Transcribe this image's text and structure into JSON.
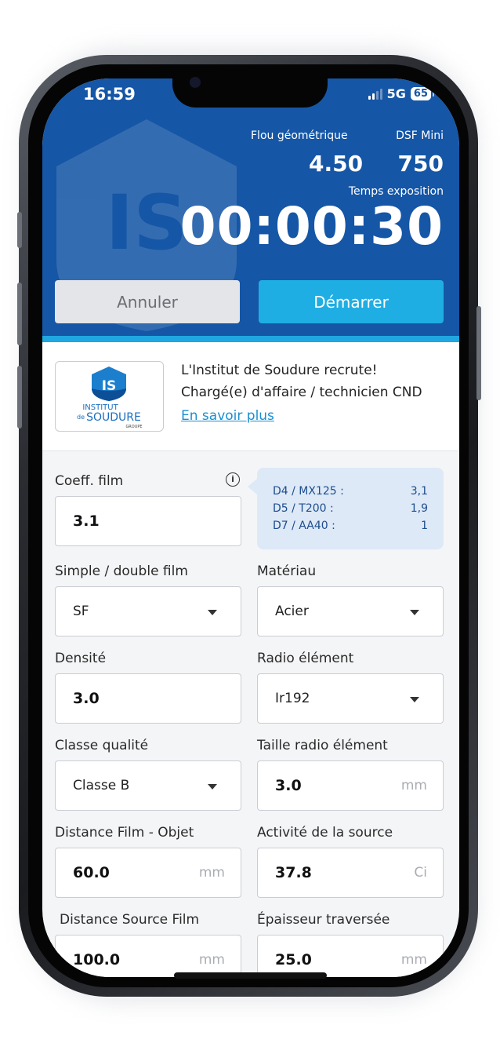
{
  "status_bar": {
    "time": "16:59",
    "network": "5G",
    "battery": "65"
  },
  "header": {
    "flou_label": "Flou géométrique",
    "flou_value": "4.50",
    "dsf_label": "DSF Mini",
    "dsf_value": "750",
    "temps_label": "Temps exposition",
    "timer": "00:00:30",
    "cancel_label": "Annuler",
    "start_label": "Démarrer",
    "bg_logo_text": "IS"
  },
  "ad": {
    "logo_badge": "IS",
    "logo_line1": "INSTITUT",
    "logo_line2": "SOUDURE",
    "logo_prefix": "de",
    "logo_line3": "GROUPE",
    "line1": "L'Institut de Soudure recrute!",
    "line2": "Chargé(e) d'affaire / technicien CND",
    "link": "En savoir plus"
  },
  "form": {
    "coeff_label": "Coeff. film",
    "coeff_value": "3.1",
    "info_icon": "i",
    "tips": [
      {
        "name": "D4 / MX125 :",
        "value": "3,1"
      },
      {
        "name": "D5 / T200 :",
        "value": "1,9"
      },
      {
        "name": "D7 / AA40 :",
        "value": "1"
      }
    ],
    "simple_label": "Simple / double film",
    "simple_value": "SF",
    "materiau_label": "Matériau",
    "materiau_value": "Acier",
    "densite_label": "Densité",
    "densite_value": "3.0",
    "radio_label": "Radio élément",
    "radio_value": "Ir192",
    "classe_label": "Classe qualité",
    "classe_value": "Classe B",
    "taille_label": "Taille radio élément",
    "taille_value": "3.0",
    "taille_unit": "mm",
    "dfo_label": "Distance Film - Objet",
    "dfo_value": "60.0",
    "dfo_unit": "mm",
    "activite_label": "Activité de la source",
    "activite_value": "37.8",
    "activite_unit": "Ci",
    "dsf_label": "Distance Source Film",
    "dsf_value": "100.0",
    "dsf_unit": "mm",
    "epaisseur_label": "Épaisseur traversée",
    "epaisseur_value": "25.0",
    "epaisseur_unit": "mm"
  },
  "colors": {
    "header_blue": "#1556a6",
    "accent_cyan": "#1faee3",
    "cancel_grey": "#e3e5e8",
    "tip_bg": "#dde9f7"
  }
}
